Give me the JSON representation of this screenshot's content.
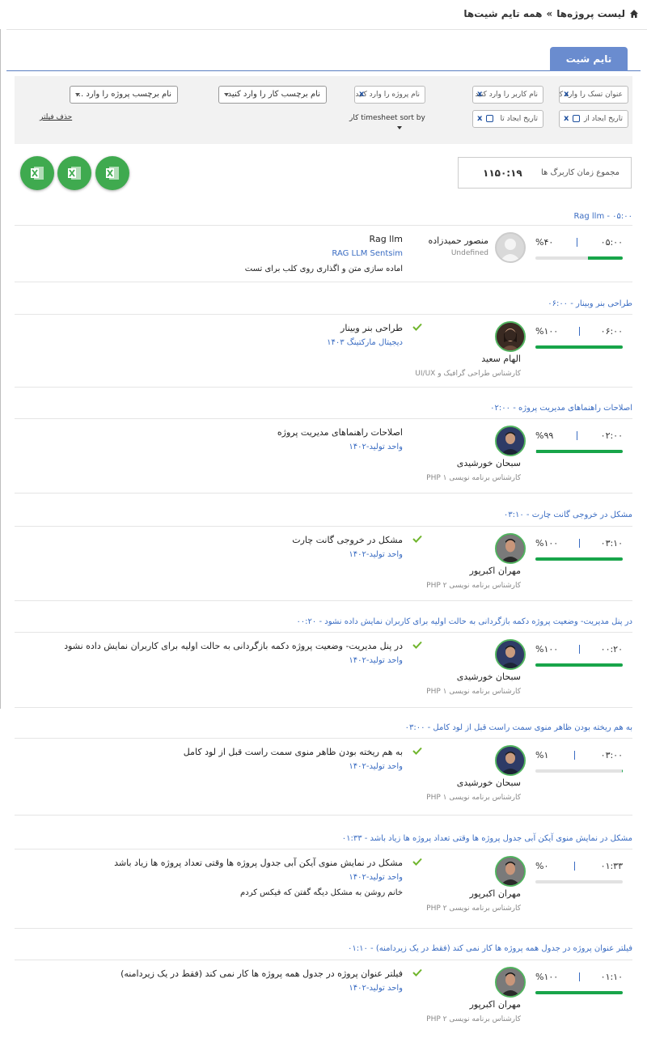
{
  "breadcrumb": {
    "parent": "لیست پروژه‌ها",
    "separator": "»",
    "current": "همه تایم شیت‌ها"
  },
  "tabs": {
    "active": "تایم شیت"
  },
  "filters": {
    "task_title": "عنوان تسک را وارد ک",
    "username": "نام کاربر را وارد کنید",
    "project_name": "نام پروژه را وارد کنید",
    "created_from": "تاریخ ایجاد از",
    "created_to": "تاریخ ایجاد تا",
    "work_tag": "نام برچسب کار را وارد کنید.",
    "project_tag": "نام برچسب پروژه را وارد ...",
    "sort_label": "timesheet sort by",
    "sort_suffix": "کار",
    "clear": "حذف فیلتر",
    "clear_symbol": "x"
  },
  "totals": {
    "label": "مجموع زمان کاربرگ ها",
    "value": "۱۱۵۰:۱۹"
  },
  "colors": {
    "accent": "#3a6cc2",
    "tab": "#6a8ccf",
    "progress": "#18a54a",
    "excel": "#3faa4f"
  },
  "groups": [
    {
      "title": "Rag llm - ۰۵:۰۰",
      "time": "۰۵:۰۰",
      "percent": "%۴۰",
      "progress": 0.4,
      "avatar": "placeholder",
      "name": "منصور حمیدزاده",
      "role": "Undefined",
      "check": false,
      "task": "Rag llm",
      "project": "RAG LLM Sentsim",
      "note": "اماده سازی متن و اگذاری روی کلب برای تست"
    },
    {
      "title": "طراحی بنر وبینار - ۰۶:۰۰",
      "time": "۰۶:۰۰",
      "percent": "%۱۰۰",
      "progress": 1.0,
      "avatar": "female",
      "name": "الهام سعید",
      "role": "کارشناس طراحی گرافیک و UI/UX",
      "check": true,
      "task": "طراحی بنر وبینار",
      "project": "دیجیتال مارکتینگ ۱۴۰۳",
      "note": ""
    },
    {
      "title": "اصلاحات راهنماهای مدیریت پروژه - ۰۲:۰۰",
      "time": "۰۲:۰۰",
      "percent": "%۹۹",
      "progress": 0.99,
      "avatar": "male1",
      "name": "سبحان خورشیدی",
      "role": "کارشناس برنامه نویسی PHP ۱",
      "check": false,
      "task": "اصلاحات راهنماهای مدیریت پروژه",
      "project": "واحد تولید-۱۴۰۲",
      "note": ""
    },
    {
      "title": "مشکل در خروجی گانت چارت - ۰۳:۱۰",
      "time": "۰۳:۱۰",
      "percent": "%۱۰۰",
      "progress": 1.0,
      "avatar": "male2",
      "name": "مهران اکبرپور",
      "role": "کارشناس برنامه نویسی PHP ۲",
      "check": true,
      "task": "مشکل در خروجی گانت چارت",
      "project": "واحد تولید-۱۴۰۲",
      "note": ""
    },
    {
      "title": "در پنل مدیریت- وضعیت پروژه دکمه بازگردانی به حالت اولیه برای کاربران نمایش داده نشود - ۰۰:۲۰",
      "time": "۰۰:۲۰",
      "percent": "%۱۰۰",
      "progress": 1.0,
      "avatar": "male1",
      "name": "سبحان خورشیدی",
      "role": "کارشناس برنامه نویسی PHP ۱",
      "check": true,
      "task": "در پنل مدیریت- وضعیت پروژه دکمه بازگردانی به حالت اولیه برای کاربران نمایش داده نشود",
      "project": "واحد تولید-۱۴۰۲",
      "note": ""
    },
    {
      "title": "به هم ریخته بودن ظاهر منوی سمت راست قبل از لود کامل - ۰۳:۰۰",
      "time": "۰۳:۰۰",
      "percent": "%۱",
      "progress": 0.01,
      "avatar": "male1",
      "name": "سبحان خورشیدی",
      "role": "کارشناس برنامه نویسی PHP ۱",
      "check": true,
      "task": "به هم ریخته بودن ظاهر منوی سمت راست قبل از لود کامل",
      "project": "واحد تولید-۱۴۰۲",
      "note": ""
    },
    {
      "title": "مشکل در نمایش منوی آیکن آبی جدول پروژه ها وقتی تعداد پروژه ها زیاد باشد - ۰۱:۳۳",
      "time": "۰۱:۳۳",
      "percent": "%۰",
      "progress": 0.0,
      "avatar": "male2",
      "name": "مهران اکبرپور",
      "role": "کارشناس برنامه نویسی PHP ۲",
      "check": true,
      "task": "مشکل در نمایش منوی آیکن آبی جدول پروژه ها وقتی تعداد پروژه ها زیاد باشد",
      "project": "واحد تولید-۱۴۰۲",
      "note": "خانم روشن به مشکل دیگه گفتن که فیکس کردم"
    },
    {
      "title": "فیلتر عنوان پروژه در جدول همه پروژه ها کار نمی کند (فقط در یک زیردامنه) - ۰۱:۱۰",
      "time": "۰۱:۱۰",
      "percent": "%۱۰۰",
      "progress": 1.0,
      "avatar": "male2",
      "name": "مهران اکبرپور",
      "role": "کارشناس برنامه نویسی PHP ۲",
      "check": true,
      "task": "فیلتر عنوان پروژه در جدول همه پروژه ها کار نمی کند (فقط در یک زیردامنه)",
      "project": "واحد تولید-۱۴۰۲",
      "note": ""
    }
  ]
}
